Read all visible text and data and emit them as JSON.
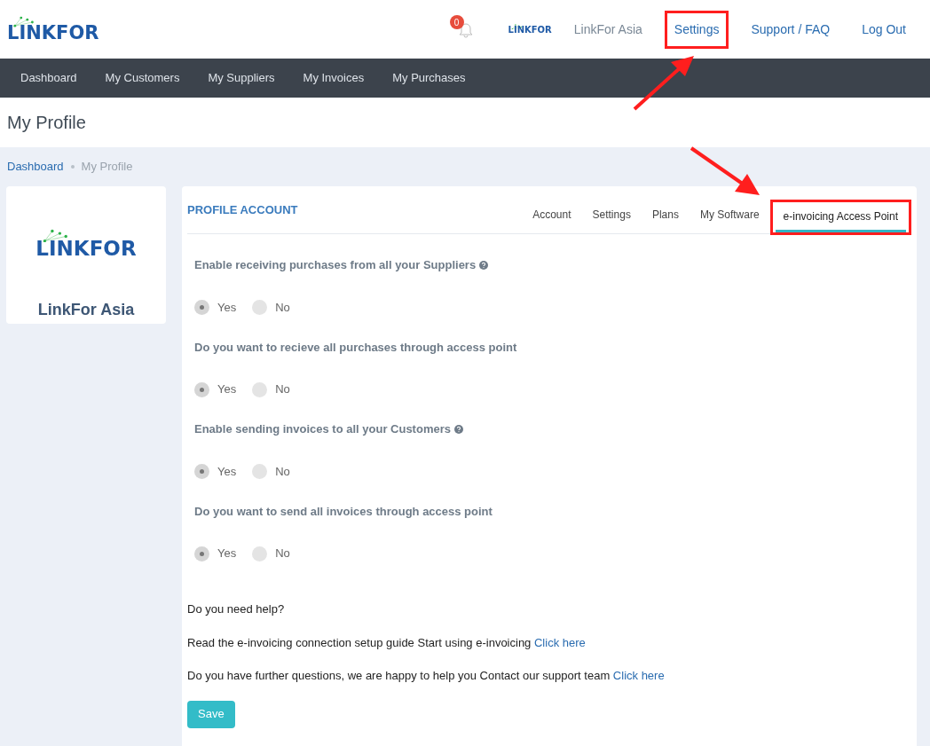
{
  "header": {
    "logo": "LINKFOR",
    "notification_count": "0",
    "company_logo": "LINKFOR",
    "links": [
      {
        "label": "LinkFor Asia",
        "kind": "plain",
        "highlighted": false
      },
      {
        "label": "Settings",
        "kind": "link",
        "highlighted": true
      },
      {
        "label": "Support / FAQ",
        "kind": "link",
        "highlighted": false
      },
      {
        "label": "Log Out",
        "kind": "link",
        "highlighted": false
      }
    ]
  },
  "nav": [
    "Dashboard",
    "My Customers",
    "My Suppliers",
    "My Invoices",
    "My Purchases"
  ],
  "page_title": "My Profile",
  "breadcrumb": [
    {
      "label": "Dashboard",
      "kind": "link"
    },
    {
      "label": "My Profile",
      "kind": "current"
    }
  ],
  "profile_card": {
    "logo": "LINKFOR",
    "name": "LinkFor Asia"
  },
  "panel": {
    "title": "PROFILE ACCOUNT",
    "tabs": [
      {
        "label": "Account",
        "selected": false,
        "highlighted": false
      },
      {
        "label": "Settings",
        "selected": false,
        "highlighted": false
      },
      {
        "label": "Plans",
        "selected": false,
        "highlighted": false
      },
      {
        "label": "My Software",
        "selected": false,
        "highlighted": false
      },
      {
        "label": "e-invoicing Access Point",
        "selected": true,
        "highlighted": true
      }
    ],
    "questions": [
      {
        "label": "Enable receiving purchases from all your Suppliers",
        "help_icon": true,
        "options": [
          {
            "label": "Yes",
            "selected": true
          },
          {
            "label": "No",
            "selected": false
          }
        ]
      },
      {
        "label": "Do you want to recieve all purchases through access point",
        "help_icon": false,
        "options": [
          {
            "label": "Yes",
            "selected": true
          },
          {
            "label": "No",
            "selected": false
          }
        ]
      },
      {
        "label": "Enable sending invoices to all your Customers",
        "help_icon": true,
        "options": [
          {
            "label": "Yes",
            "selected": true
          },
          {
            "label": "No",
            "selected": false
          }
        ]
      },
      {
        "label": "Do you want to send all invoices through access point",
        "help_icon": false,
        "options": [
          {
            "label": "Yes",
            "selected": true
          },
          {
            "label": "No",
            "selected": false
          }
        ]
      }
    ],
    "help_title": "Do you need help?",
    "help_lines": [
      {
        "text": "Read the e-invoicing connection setup guide Start using e-invoicing",
        "link": "Click here"
      },
      {
        "text": "Do you have further questions, we are happy to help you Contact our support team",
        "link": "Click here"
      }
    ],
    "save_button": "Save"
  }
}
